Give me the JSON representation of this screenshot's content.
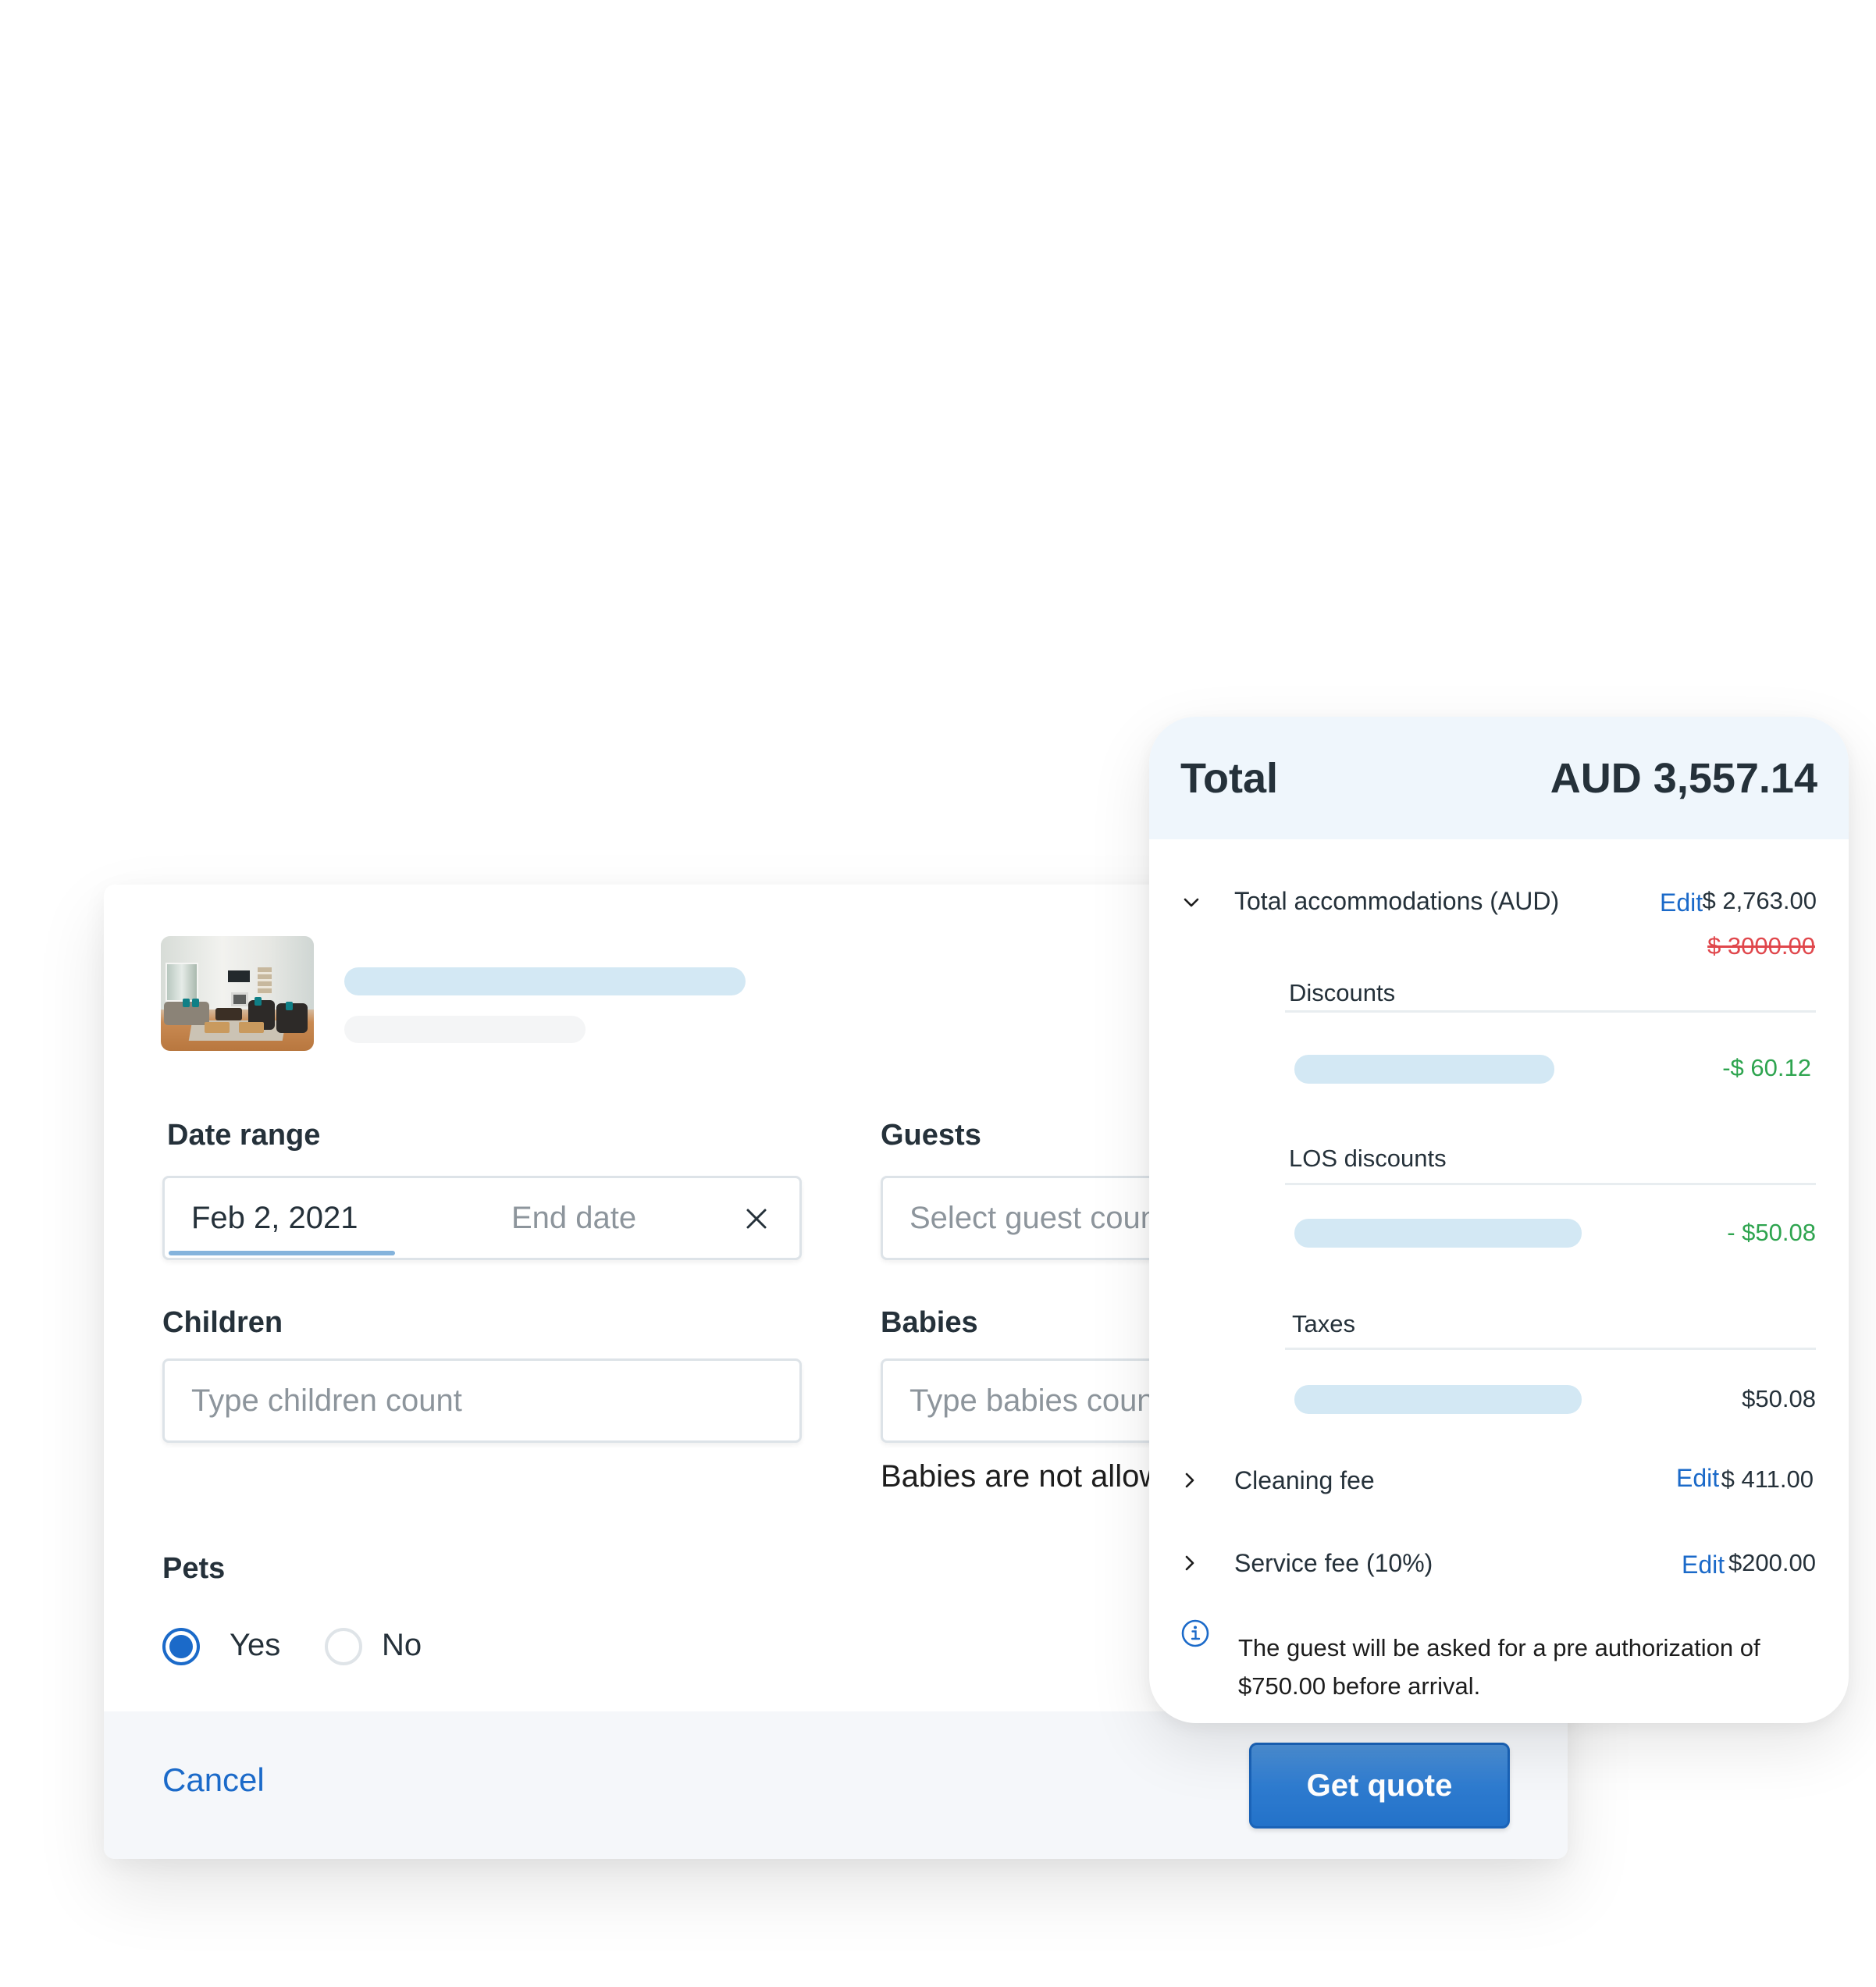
{
  "form": {
    "property_thumbnail": "living-room-photo",
    "date_range": {
      "label": "Date range",
      "start_value": "Feb 2, 2021",
      "end_placeholder": "End date",
      "clear_icon": "close-icon"
    },
    "guests": {
      "label": "Guests",
      "placeholder": "Select guest count"
    },
    "children": {
      "label": "Children",
      "placeholder": "Type children count"
    },
    "babies": {
      "label": "Babies",
      "placeholder": "Type babies count",
      "helper": "Babies are not allowed"
    },
    "pets": {
      "label": "Pets",
      "options": [
        {
          "label": "Yes",
          "selected": true
        },
        {
          "label": "No",
          "selected": false
        }
      ]
    },
    "footer": {
      "cancel_label": "Cancel",
      "submit_label": "Get quote"
    }
  },
  "quote": {
    "total_label": "Total",
    "total_value": "AUD 3,557.14",
    "rows": {
      "accommodations": {
        "label": "Total accommodations (AUD)",
        "expanded": true,
        "edit_label": "Edit",
        "amount": "$ 2,763.00",
        "original_amount": "$ 3000.00"
      },
      "discounts": {
        "label": "Discounts",
        "amount": "-$ 60.12"
      },
      "los_discounts": {
        "label": "LOS discounts",
        "amount": "- $50.08"
      },
      "taxes": {
        "label": "Taxes",
        "amount": "$50.08"
      },
      "cleaning": {
        "label": "Cleaning fee",
        "expanded": false,
        "edit_label": "Edit",
        "amount": "$ 411.00"
      },
      "service": {
        "label": "Service fee (10%)",
        "expanded": false,
        "edit_label": "Edit",
        "amount": "$200.00"
      }
    },
    "info_note": "The guest will be asked for a pre authorization of $750.00 before arrival."
  },
  "colors": {
    "accent": "#1b6ac9",
    "header_bg": "#eff6fc",
    "discount_green": "#2ea44f",
    "strike_red": "#e0474c",
    "skeleton": "#d3e8f4"
  }
}
